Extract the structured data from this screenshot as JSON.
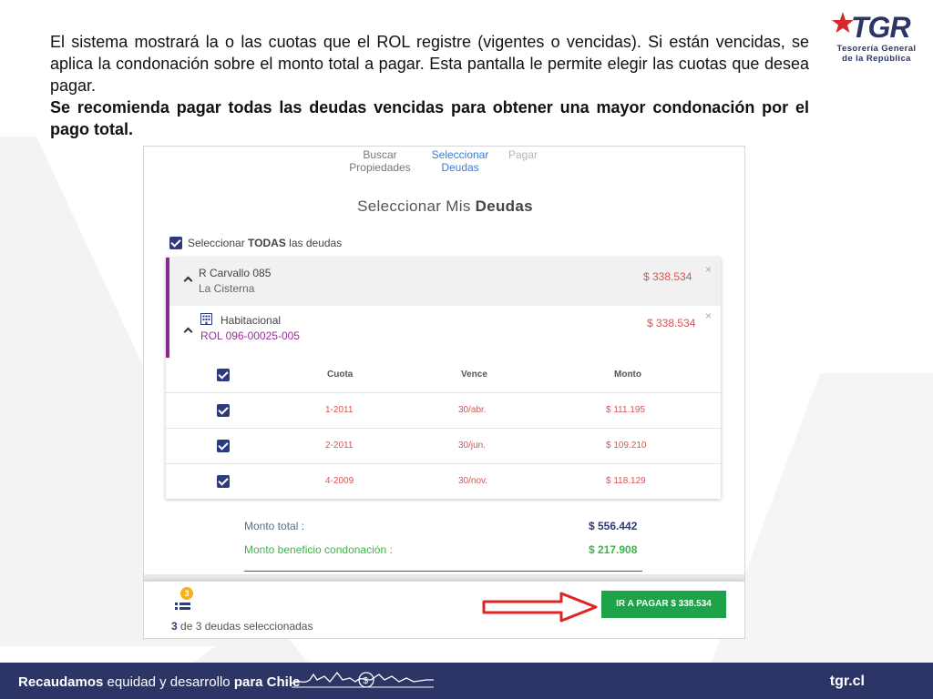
{
  "slide": {
    "paragraph1": "El sistema mostrará la o las cuotas que el ROL registre (vigentes o vencidas). Si están vencidas, se aplica la condonación sobre el monto total a pagar. Esta pantalla le permite elegir las cuotas que desea pagar.",
    "paragraph2": "Se recomienda pagar todas las deudas vencidas para obtener una mayor condonación por el pago total."
  },
  "logo": {
    "letters": "TGR",
    "line1": "Tesorería General",
    "line2": "de la República"
  },
  "steps": [
    {
      "line1": "Buscar",
      "line2": "Propiedades",
      "state": "done"
    },
    {
      "line1": "Seleccionar",
      "line2": "Deudas",
      "state": "active"
    },
    {
      "line1": "Pagar",
      "line2": "",
      "state": "pending"
    }
  ],
  "panel": {
    "title_prefix": "Seleccionar Mis ",
    "title_bold": "Deudas",
    "select_all_prefix": "Seleccionar ",
    "select_all_bold": "TODAS",
    "select_all_suffix": " las deudas",
    "select_all_checked": true
  },
  "property": {
    "name": "R Carvallo 085",
    "location": "La Cisterna",
    "amount": "$ 338.534",
    "close": "×"
  },
  "habitacional": {
    "name": "Habitacional",
    "rol": "ROL 096-00025-005",
    "amount": "$ 338.534",
    "close": "×",
    "icon": "building-icon"
  },
  "table": {
    "headers": {
      "cuota": "Cuota",
      "vence": "Vence",
      "monto": "Monto"
    },
    "rows": [
      {
        "cuota": "1-2011",
        "vence": "30/abr.",
        "monto": "$ 111.195",
        "checked": true
      },
      {
        "cuota": "2-2011",
        "vence": "30/jun.",
        "monto": "$ 109.210",
        "checked": true
      },
      {
        "cuota": "4-2009",
        "vence": "30/nov.",
        "monto": "$ 118.129",
        "checked": true
      }
    ]
  },
  "summary": {
    "total_label": "Monto total :",
    "total_value": "$ 556.442",
    "benefit_label": "Monto beneficio condonación :",
    "benefit_value": "$ 217.908"
  },
  "footer": {
    "badge_count": "3",
    "selected_count": "3",
    "selected_suffix": " de 3 deudas seleccionadas",
    "pay_button": "IR A PAGAR $ 338.534"
  },
  "banner": {
    "bold1": "Recaudamos",
    "text1": " equidad y desarrollo ",
    "bold2": "para Chile",
    "domain": "tgr.cl"
  },
  "colors": {
    "navy": "#2c3566",
    "accent_purple": "#8a2a8f",
    "amount_red": "#d9534f",
    "green": "#43b14a",
    "button_green": "#1fa34a",
    "arrow_red": "#e02424"
  }
}
